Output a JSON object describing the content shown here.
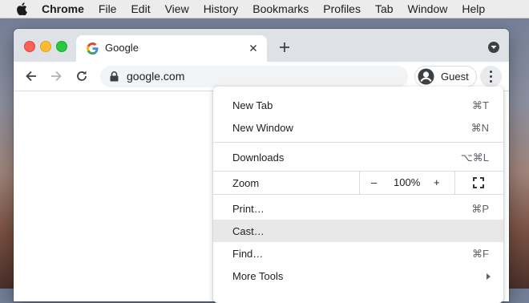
{
  "menubar": {
    "app": "Chrome",
    "items": [
      "File",
      "Edit",
      "View",
      "History",
      "Bookmarks",
      "Profiles",
      "Tab",
      "Window",
      "Help"
    ]
  },
  "tab": {
    "title": "Google"
  },
  "omnibox": {
    "url": "google.com"
  },
  "profile": {
    "label": "Guest"
  },
  "menu": {
    "new_tab": {
      "label": "New Tab",
      "shortcut": "⌘T"
    },
    "new_window": {
      "label": "New Window",
      "shortcut": "⌘N"
    },
    "downloads": {
      "label": "Downloads",
      "shortcut": "⌥⌘L"
    },
    "zoom": {
      "label": "Zoom",
      "minus": "–",
      "value": "100%",
      "plus": "+"
    },
    "print": {
      "label": "Print…",
      "shortcut": "⌘P"
    },
    "cast": {
      "label": "Cast…"
    },
    "find": {
      "label": "Find…",
      "shortcut": "⌘F"
    },
    "more_tools": {
      "label": "More Tools"
    }
  },
  "colors": {
    "tabstrip": "#dee1e6",
    "highlight": "#e8e8e8",
    "traffic_red": "#fe5f57",
    "traffic_yellow": "#febc2e",
    "traffic_green": "#28c840"
  },
  "icons": [
    "apple-logo-icon",
    "google-g-icon",
    "close-icon",
    "plus-icon",
    "tab-search-icon",
    "back-arrow-icon",
    "forward-arrow-icon",
    "reload-icon",
    "lock-icon",
    "guest-avatar-icon",
    "kebab-menu-icon",
    "fullscreen-icon",
    "chevron-right-icon"
  ]
}
